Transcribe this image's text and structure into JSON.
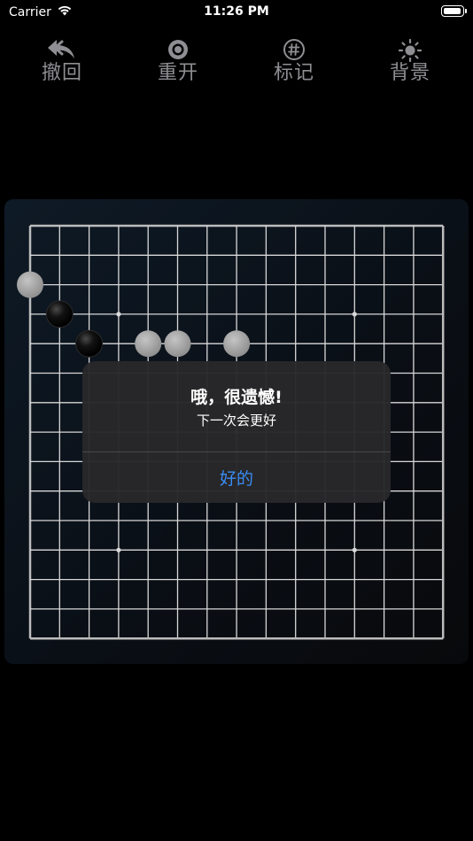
{
  "status_bar": {
    "carrier": "Carrier",
    "time": "11:26 PM",
    "battery_level": 0.95
  },
  "toolbar": {
    "items": [
      {
        "label": "撤回",
        "icon": "undo-icon"
      },
      {
        "label": "重开",
        "icon": "restart-icon"
      },
      {
        "label": "标记",
        "icon": "mark-icon"
      },
      {
        "label": "背景",
        "icon": "background-icon"
      }
    ]
  },
  "board": {
    "size": 15,
    "star_points": [
      [
        3,
        3
      ],
      [
        3,
        11
      ],
      [
        11,
        3
      ],
      [
        11,
        11
      ],
      [
        7,
        7
      ]
    ],
    "stones": [
      {
        "col": 0,
        "row": 2,
        "color": "white"
      },
      {
        "col": 1,
        "row": 3,
        "color": "black"
      },
      {
        "col": 2,
        "row": 4,
        "color": "black"
      },
      {
        "col": 4,
        "row": 4,
        "color": "white"
      },
      {
        "col": 5,
        "row": 4,
        "color": "white"
      },
      {
        "col": 7,
        "row": 4,
        "color": "white"
      }
    ],
    "colors": {
      "grid": "#d8d8d8",
      "border": "#bcbcbc",
      "black_stone": "#0a0a0a",
      "white_stone": "#a9a9a9"
    }
  },
  "alert": {
    "title": "哦，很遗憾!",
    "message": "下一次会更好",
    "button_label": "好的",
    "accent_color": "#3a8cf4"
  }
}
